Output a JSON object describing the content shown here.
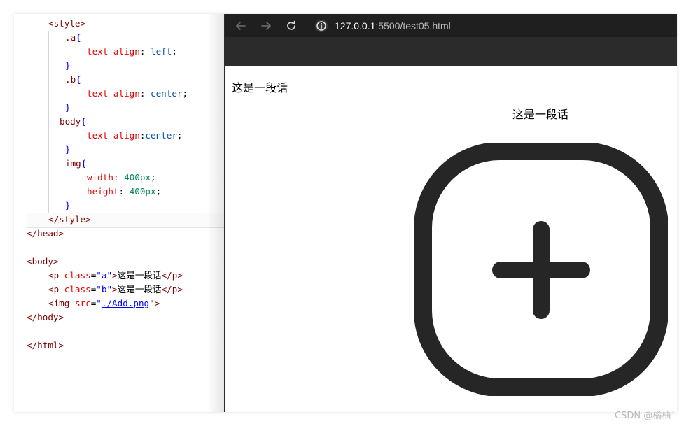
{
  "editor": {
    "lines": {
      "l0": [
        "<style>"
      ],
      "l1": [
        ".a",
        "{"
      ],
      "l2": [
        "text-align",
        ":",
        "left",
        ";"
      ],
      "l3": [
        "}"
      ],
      "l4": [
        ".b",
        "{"
      ],
      "l5": [
        "text-align",
        ":",
        "center",
        ";"
      ],
      "l6": [
        "}"
      ],
      "l7": [
        "body",
        "{"
      ],
      "l8": [
        "text-align",
        ":",
        "center",
        ";"
      ],
      "l9": [
        "}"
      ],
      "l10": [
        "img",
        "{"
      ],
      "l11": [
        "width",
        ":",
        "400px",
        ";"
      ],
      "l12": [
        "height",
        ":",
        "400px",
        ";"
      ],
      "l13": [
        "}"
      ],
      "l14": [
        "</style>"
      ],
      "l15": [
        "</head>"
      ],
      "l16": [
        "<body>"
      ],
      "l17": [
        "<p",
        "class",
        "=",
        "\"a\"",
        ">",
        "这是一段话",
        "</p>"
      ],
      "l18": [
        "<p",
        "class",
        "=",
        "\"b\"",
        ">",
        "这是一段话",
        "</p>"
      ],
      "l19": [
        "<img",
        "src",
        "=",
        "\"",
        "./Add.png",
        "\"",
        ">"
      ],
      "l20": [
        "</body>"
      ],
      "l21": [
        "</html>"
      ]
    }
  },
  "browser": {
    "url_host": "127.0.0.1",
    "url_rest": ":5500/test05.html",
    "para_a": "这是一段话",
    "para_b": "这是一段话",
    "icons": {
      "back": "arrow-left-icon",
      "forward": "arrow-right-icon",
      "reload": "reload-icon",
      "info": "info-icon",
      "image": "plus-square-icon"
    }
  },
  "watermark": "CSDN @橘柚！",
  "colors": {
    "toolbar_bg": "#1f1f1f",
    "subbar_bg": "#2b2b2b",
    "tag": "#800000",
    "attr": "#e50000",
    "string": "#0000ff",
    "value": "#0451a5",
    "number": "#098658"
  }
}
